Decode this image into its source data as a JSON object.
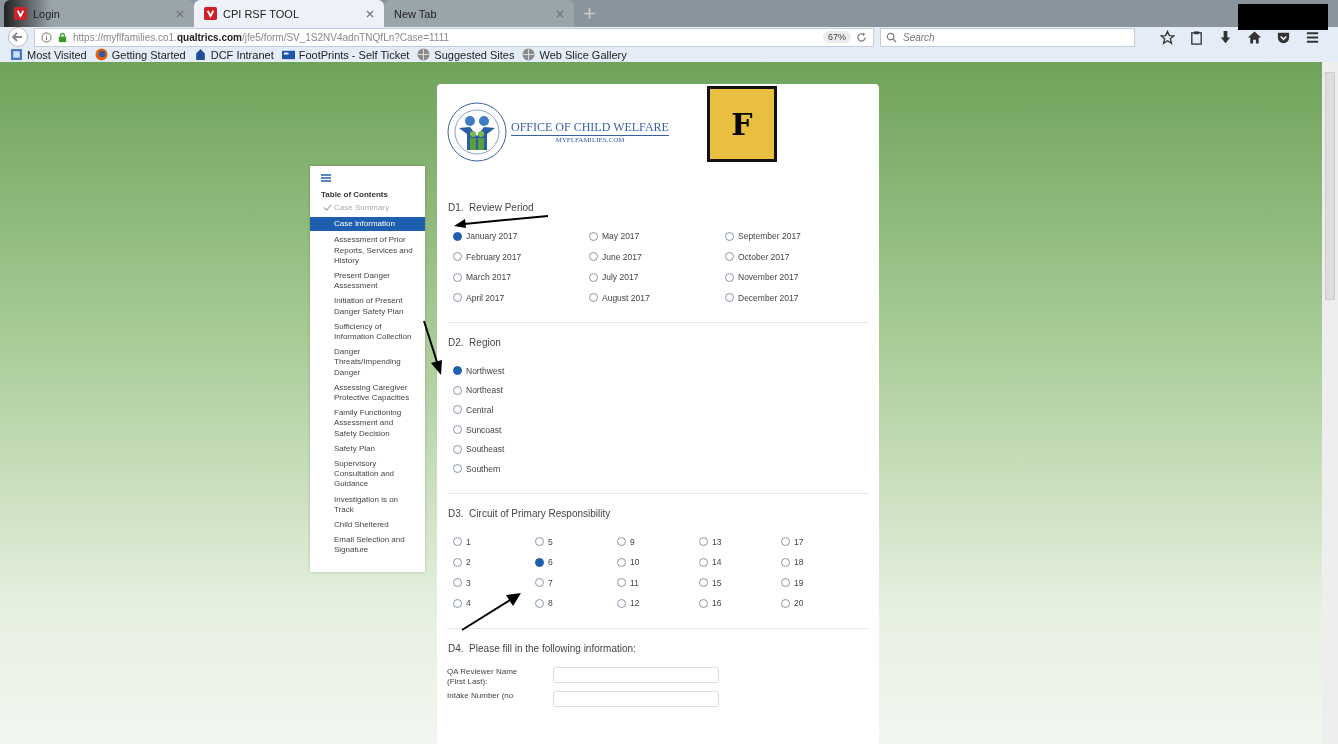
{
  "browser": {
    "tabs": [
      {
        "label": "Login",
        "selected": false
      },
      {
        "label": "CPI RSF TOOL",
        "selected": true
      },
      {
        "label": "New Tab",
        "selected": false
      }
    ],
    "url": "https://myflfamilies.co1.**qualtrics.com**/jfe5/form/SV_1S2NV4adnTNQfLn?Case=1111",
    "zoom": "67%",
    "search": {
      "placeholder": "Search"
    },
    "bookmarks": [
      {
        "label": "Most Visited",
        "kind": "page"
      },
      {
        "label": "Getting Started",
        "kind": "firefox"
      },
      {
        "label": "DCF Intranet",
        "kind": "building"
      },
      {
        "label": "FootPrints - Self Ticket",
        "kind": "card"
      },
      {
        "label": "Suggested Sites",
        "kind": "globe"
      },
      {
        "label": "Web Slice Gallery",
        "kind": "globe"
      }
    ]
  },
  "toc": {
    "title": "Table of Contents",
    "items": [
      {
        "label": "Case Summary",
        "completed": true,
        "selected": false
      },
      {
        "label": "Case Information",
        "completed": false,
        "selected": true
      },
      {
        "label": "Assessment of Prior Reports, Services and History",
        "completed": false,
        "selected": false
      },
      {
        "label": "Present Danger Assessment",
        "completed": false,
        "selected": false
      },
      {
        "label": "Initiation of Present Danger Safety Plan",
        "completed": false,
        "selected": false
      },
      {
        "label": "Sufficiency of Information Collection",
        "completed": false,
        "selected": false
      },
      {
        "label": "Danger Threats/Impending Danger",
        "completed": false,
        "selected": false
      },
      {
        "label": "Assessing Caregiver Protective Capacities",
        "completed": false,
        "selected": false
      },
      {
        "label": "Family Functioning Assessment and Safety Decision",
        "completed": false,
        "selected": false
      },
      {
        "label": "Safety Plan",
        "completed": false,
        "selected": false
      },
      {
        "label": "Supervisory Consultation and Guidance",
        "completed": false,
        "selected": false
      },
      {
        "label": "Investigation is on Track",
        "completed": false,
        "selected": false
      },
      {
        "label": "Child Sheltered",
        "completed": false,
        "selected": false
      },
      {
        "label": "Email Selection and Signature",
        "completed": false,
        "selected": false
      }
    ]
  },
  "header": {
    "title": "OFFICE OF CHILD WELFARE",
    "subtitle": "MYFLFAMILIES.COM",
    "badge": "F"
  },
  "questions": [
    {
      "number": "D1.",
      "title": "Review Period",
      "kind": "grid3",
      "options": [
        {
          "label": "January 2017",
          "selected": true
        },
        {
          "label": "February 2017",
          "selected": false
        },
        {
          "label": "March 2017",
          "selected": false
        },
        {
          "label": "April 2017",
          "selected": false
        },
        {
          "label": "May 2017",
          "selected": false
        },
        {
          "label": "June 2017",
          "selected": false
        },
        {
          "label": "July 2017",
          "selected": false
        },
        {
          "label": "August 2017",
          "selected": false
        },
        {
          "label": "September 2017",
          "selected": false
        },
        {
          "label": "October 2017",
          "selected": false
        },
        {
          "label": "November 2017",
          "selected": false
        },
        {
          "label": "December 2017",
          "selected": false
        }
      ]
    },
    {
      "number": "D2.",
      "title": "Region",
      "kind": "list",
      "options": [
        {
          "label": "Northwest",
          "selected": true
        },
        {
          "label": "Northeast",
          "selected": false
        },
        {
          "label": "Central",
          "selected": false
        },
        {
          "label": "Suncoast",
          "selected": false
        },
        {
          "label": "Southeast",
          "selected": false
        },
        {
          "label": "Southern",
          "selected": false
        }
      ]
    },
    {
      "number": "D3.",
      "title": "Circuit of Primary Responsibility",
      "kind": "grid5",
      "options": [
        {
          "label": "1",
          "selected": false
        },
        {
          "label": "2",
          "selected": false
        },
        {
          "label": "3",
          "selected": false
        },
        {
          "label": "4",
          "selected": false
        },
        {
          "label": "5",
          "selected": false
        },
        {
          "label": "6",
          "selected": true
        },
        {
          "label": "7",
          "selected": false
        },
        {
          "label": "8",
          "selected": false
        },
        {
          "label": "9",
          "selected": false
        },
        {
          "label": "10",
          "selected": false
        },
        {
          "label": "11",
          "selected": false
        },
        {
          "label": "12",
          "selected": false
        },
        {
          "label": "13",
          "selected": false
        },
        {
          "label": "14",
          "selected": false
        },
        {
          "label": "15",
          "selected": false
        },
        {
          "label": "16",
          "selected": false
        },
        {
          "label": "17",
          "selected": false
        },
        {
          "label": "18",
          "selected": false
        },
        {
          "label": "19",
          "selected": false
        },
        {
          "label": "20",
          "selected": false
        }
      ]
    },
    {
      "number": "D4.",
      "title": "Please fill in the following information:",
      "kind": "fields",
      "fields": [
        {
          "label": "QA Reviewer Name (First Last):"
        },
        {
          "label": "Intake Number (no"
        }
      ]
    }
  ]
}
